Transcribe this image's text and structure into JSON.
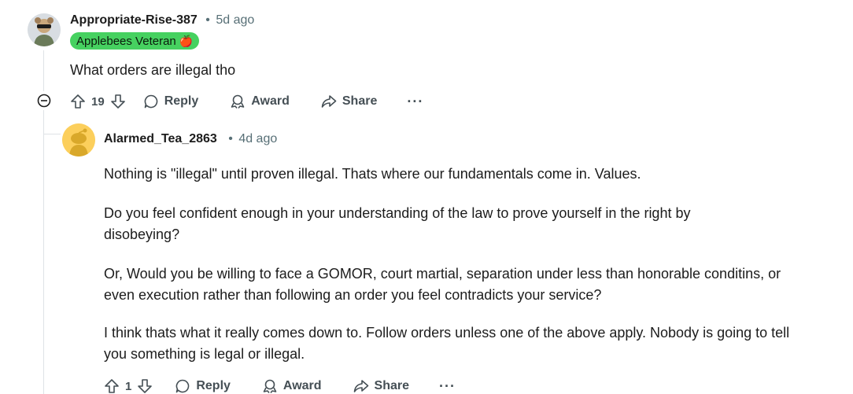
{
  "parent_comment": {
    "author": "Appropriate-Rise-387",
    "separator": "•",
    "age": "5d ago",
    "flair": "Applebees Veteran",
    "flair_emoji": "🍎",
    "body": "What orders are illegal tho",
    "votes": "19",
    "reply_label": "Reply",
    "award_label": "Award",
    "share_label": "Share",
    "more_label": "···"
  },
  "reply_comment": {
    "author": "Alarmed_Tea_2863",
    "separator": "•",
    "age": "4d ago",
    "paragraphs": [
      "Nothing is \"illegal\" until proven illegal. Thats where our fundamentals come in. Values.",
      "Do you feel confident enough in your understanding of the law to prove yourself in the right by disobeying?",
      "Or, Would you be willing to face a GOMOR, court martial, separation under less than honorable conditins, or even execution rather than following an order you feel contradicts your service?",
      "I think thats what it really comes down to. Follow orders unless one of the above apply. Nobody is going to tell you something is legal or illegal."
    ],
    "votes": "1",
    "reply_label": "Reply",
    "award_label": "Award",
    "share_label": "Share",
    "more_label": "···"
  },
  "colors": {
    "flair_bg": "#46d160",
    "meta": "#576f76",
    "action": "#454f55",
    "thread_line": "#dfe3e6",
    "reply_avatar": "#fccf5c"
  }
}
